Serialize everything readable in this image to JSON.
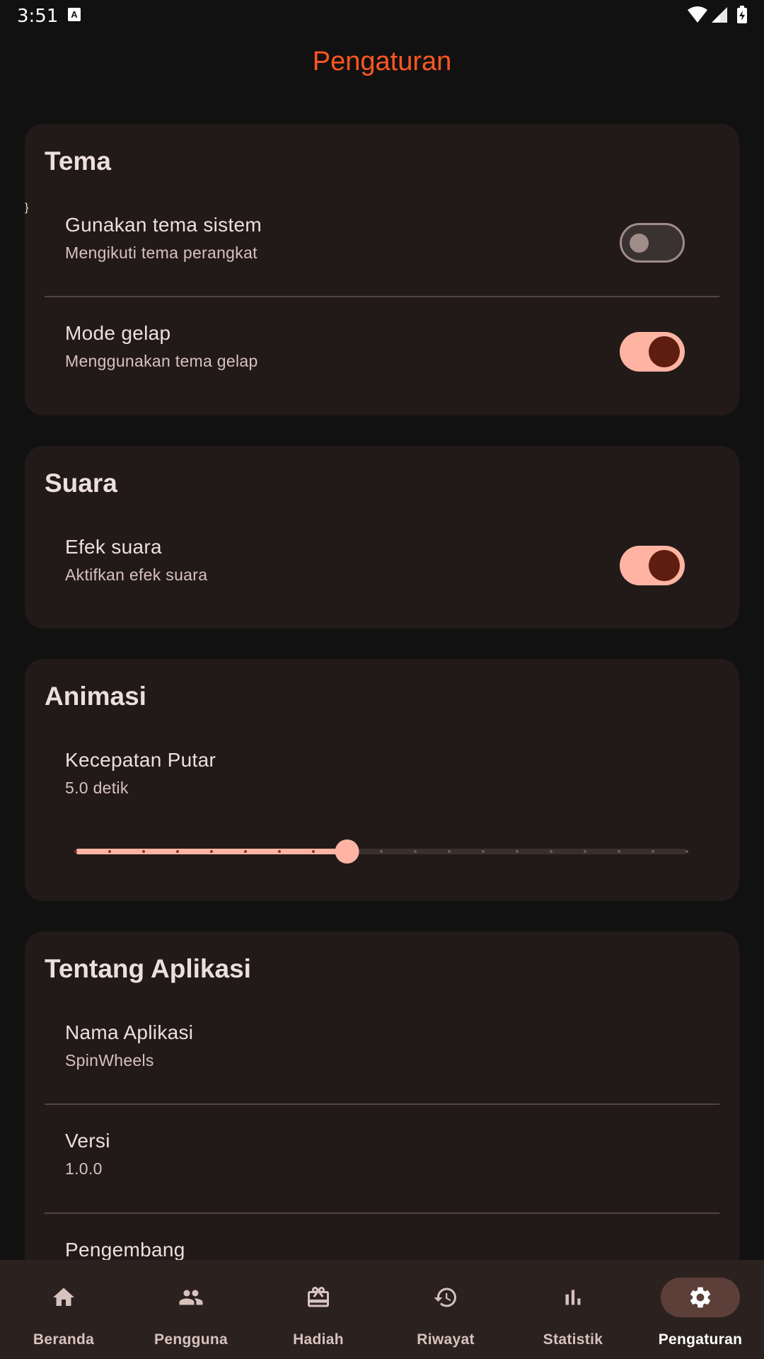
{
  "status_bar": {
    "time": "3:51",
    "notification_icon": "A"
  },
  "app_bar": {
    "title": "Pengaturan"
  },
  "sections": {
    "theme": {
      "title": "Tema",
      "items": [
        {
          "title": "Gunakan tema sistem",
          "subtitle": "Mengikuti tema perangkat",
          "switch": "off"
        },
        {
          "title": "Mode gelap",
          "subtitle": "Menggunakan tema gelap",
          "switch": "on"
        }
      ]
    },
    "sound": {
      "title": "Suara",
      "items": [
        {
          "title": "Efek suara",
          "subtitle": "Aktifkan efek suara",
          "switch": "on"
        }
      ]
    },
    "animation": {
      "title": "Animasi",
      "items": [
        {
          "title": "Kecepatan Putar",
          "subtitle": "5.0 detik"
        }
      ],
      "slider": {
        "value": 0.444,
        "divisions": 18
      }
    },
    "about": {
      "title": "Tentang Aplikasi",
      "items": [
        {
          "title": "Nama Aplikasi",
          "subtitle": "SpinWheels"
        },
        {
          "title": "Versi",
          "subtitle": "1.0.0"
        },
        {
          "title": "Pengembang",
          "subtitle": ""
        }
      ]
    }
  },
  "bottom_nav": {
    "items": [
      {
        "label": "Beranda",
        "icon": "home-icon"
      },
      {
        "label": "Pengguna",
        "icon": "people-icon"
      },
      {
        "label": "Hadiah",
        "icon": "gift-icon"
      },
      {
        "label": "Riwayat",
        "icon": "history-icon"
      },
      {
        "label": "Statistik",
        "icon": "bar-chart-icon"
      },
      {
        "label": "Pengaturan",
        "icon": "settings-icon",
        "active": true
      }
    ]
  },
  "colors": {
    "background": "#121111",
    "card": "#221a19",
    "accent_title": "#ff5722",
    "switch_on_track": "#ffb4a3",
    "switch_on_knob": "#5f1d0f",
    "nav_active_pill": "#5d3f3a"
  }
}
